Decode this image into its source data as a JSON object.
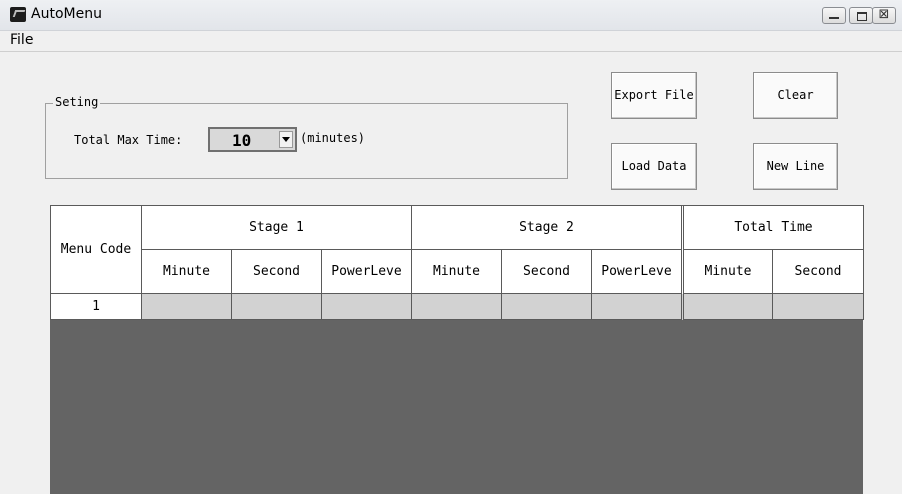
{
  "window": {
    "title": "AutoMenu",
    "controls": [
      "minimize",
      "maximize",
      "close"
    ],
    "close_glyph": "⊠"
  },
  "menubar": {
    "items": [
      {
        "label": "File"
      }
    ]
  },
  "settings": {
    "group_title": "Seting",
    "max_time_label": "Total Max Time:",
    "max_time_value": "10",
    "unit": "(minutes)"
  },
  "buttons": {
    "export": "Export File",
    "clear": "Clear",
    "load": "Load Data",
    "new_line": "New Line"
  },
  "table": {
    "menu_code_header": "Menu Code",
    "groups": [
      "Stage 1",
      "Stage 2",
      "Total Time"
    ],
    "sub_headers": [
      "Minute",
      "Second",
      "PowerLeve",
      "Minute",
      "Second",
      "PowerLeve",
      "Minute",
      "Second"
    ],
    "rows": [
      {
        "code": "1",
        "cells": [
          "",
          "",
          "",
          "",
          "",
          "",
          "",
          ""
        ]
      }
    ]
  },
  "colors": {
    "background": "#f0f0f0",
    "table_empty_area": "#646464",
    "row_cells": "#d2d2d2"
  }
}
